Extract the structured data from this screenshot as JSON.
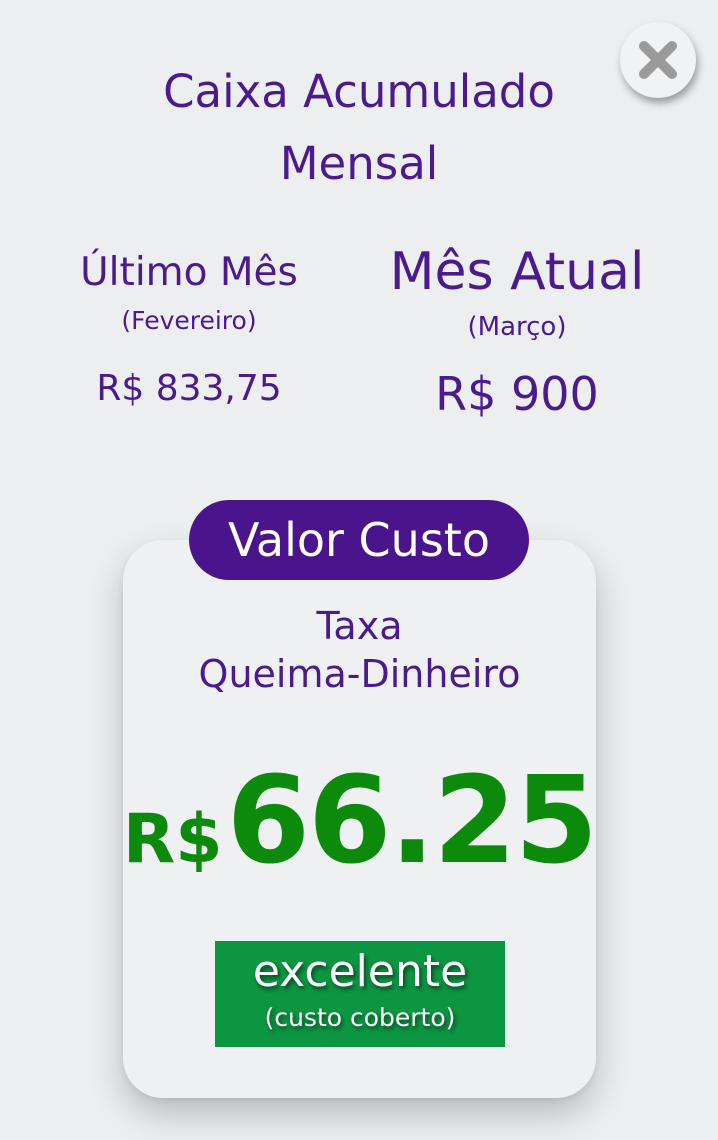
{
  "close_button": {
    "icon": "close-icon"
  },
  "title": {
    "line1": "Caixa Acumulado",
    "line2": "Mensal"
  },
  "last_month": {
    "heading": "Último Mês",
    "month": "(Fevereiro)",
    "value": "R$ 833,75"
  },
  "current_month": {
    "heading": "Mês Atual",
    "month": "(Março)",
    "value": "R$ 900"
  },
  "card": {
    "badge": "Valor Custo",
    "label_line1": "Taxa",
    "label_line2": "Queima-Dinheiro",
    "currency": "R$",
    "amount": "66.25",
    "status": "excelente",
    "status_note": "(custo coberto)"
  },
  "colors": {
    "primary_purple": "#4a148c",
    "amount_green": "#0c8a0c",
    "status_green": "#0d9642",
    "background": "#eceef0"
  }
}
